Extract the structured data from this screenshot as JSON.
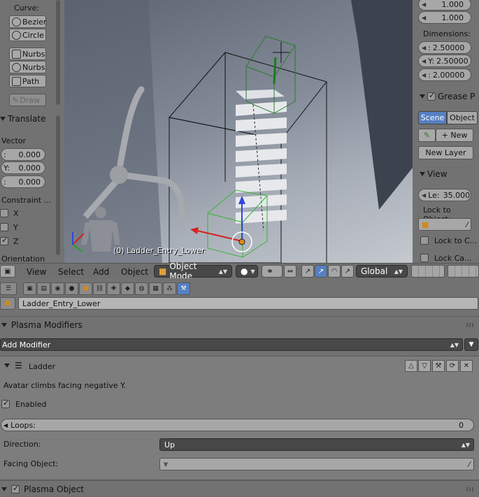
{
  "tool_shelf": {
    "curve_label": "Curve:",
    "bezier": "Bezier",
    "circle": "Circle",
    "nurbs_curve": "Nurbs",
    "nurbs_circle": "Nurbs",
    "path": "Path",
    "draw": "Draw",
    "translate_panel": "Translate",
    "vector_label": "Vector",
    "vector_x": "0.000",
    "vector_y_prefix": "Y:",
    "vector_y": "0.000",
    "vector_z": "0.000",
    "constraint_label": "Constraint ...",
    "axis_x": "X",
    "axis_y": "Y",
    "axis_z": "Z",
    "orientation_label": "Orientation"
  },
  "viewport": {
    "object_name": "(0) Ladder_Entry_Lower"
  },
  "properties_sidebar": {
    "scale_1": "1.000",
    "scale_2": "1.000",
    "dimensions_label": "Dimensions:",
    "dim_x": "2.50000",
    "dim_y_prefix": "Y:",
    "dim_y": "2.50000",
    "dim_z": "2.00000",
    "grease_panel": "Grease P",
    "tab_scene": "Scene",
    "tab_object": "Object",
    "new_button": "New",
    "new_layer_button": "New Layer",
    "view_panel": "View",
    "lens_prefix": "Le:",
    "lens_value": "35.000",
    "lock_to_object_label": "Lock to Object:",
    "lock_to_cursor": "Lock to C...",
    "lock_camera": "Lock Ca..."
  },
  "view_header": {
    "view_menu": "View",
    "select_menu": "Select",
    "add_menu": "Add",
    "object_menu": "Object",
    "mode": "Object Mode",
    "orientation": "Global"
  },
  "properties_editor": {
    "object_name": "Ladder_Entry_Lower",
    "plasma_modifiers": "Plasma Modifiers",
    "add_modifier": "Add Modifier",
    "modifier": {
      "name": "Ladder",
      "description": "Avatar climbs facing negative Y.",
      "enabled_label": "Enabled",
      "enabled": true,
      "loops_label": "Loops:",
      "loops_value": "0",
      "direction_label": "Direction:",
      "direction_value": "Up",
      "facing_label": "Facing Object:"
    },
    "plasma_object": "Plasma Object"
  },
  "colors": {
    "selected_blue": "#5680c2",
    "dark_dropdown": "#484848",
    "panel_gray": "#727272"
  }
}
